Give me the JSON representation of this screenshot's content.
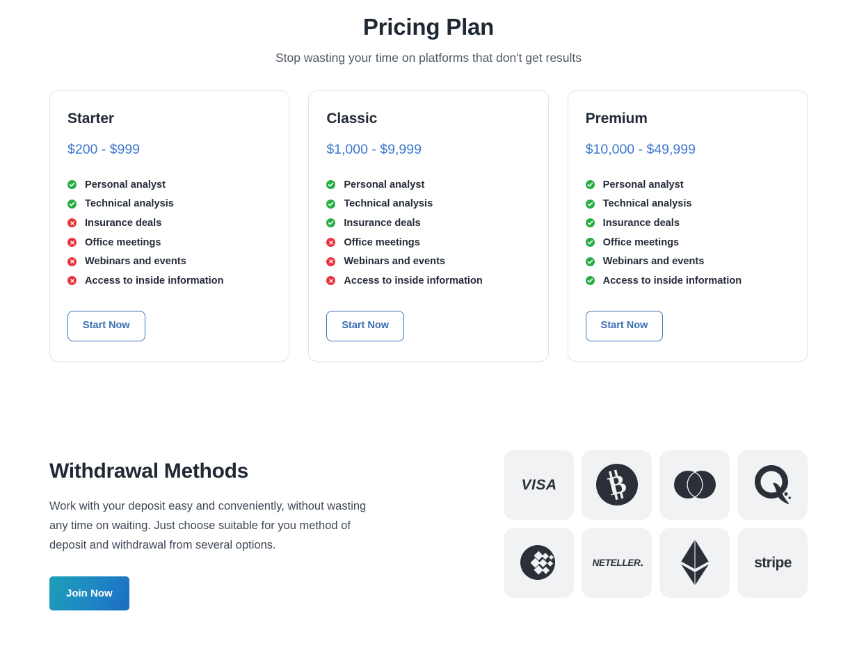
{
  "pricing": {
    "title": "Pricing Plan",
    "subtitle": "Stop wasting your time on platforms that don't get results",
    "accent_color": "#3e77cf",
    "yes_color": "#27ae44",
    "no_color": "#e8343a",
    "plans": [
      {
        "name": "Starter",
        "price": "$200 - $999",
        "cta_label": "Start Now",
        "features": [
          {
            "label": "Personal analyst",
            "included": true,
            "icon": "check-circle-icon"
          },
          {
            "label": "Technical analysis",
            "included": true,
            "icon": "check-circle-icon"
          },
          {
            "label": "Insurance deals",
            "included": false,
            "icon": "x-circle-icon"
          },
          {
            "label": "Office meetings",
            "included": false,
            "icon": "x-circle-icon"
          },
          {
            "label": "Webinars and events",
            "included": false,
            "icon": "x-circle-icon"
          },
          {
            "label": "Access to inside information",
            "included": false,
            "icon": "x-circle-icon"
          }
        ]
      },
      {
        "name": "Classic",
        "price": "$1,000 - $9,999",
        "cta_label": "Start Now",
        "features": [
          {
            "label": "Personal analyst",
            "included": true,
            "icon": "check-circle-icon"
          },
          {
            "label": "Technical analysis",
            "included": true,
            "icon": "check-circle-icon"
          },
          {
            "label": "Insurance deals",
            "included": true,
            "icon": "check-circle-icon"
          },
          {
            "label": "Office meetings",
            "included": false,
            "icon": "x-circle-icon"
          },
          {
            "label": "Webinars and events",
            "included": false,
            "icon": "x-circle-icon"
          },
          {
            "label": "Access to inside information",
            "included": false,
            "icon": "x-circle-icon"
          }
        ]
      },
      {
        "name": "Premium",
        "price": "$10,000 - $49,999",
        "cta_label": "Start Now",
        "features": [
          {
            "label": "Personal analyst",
            "included": true,
            "icon": "check-circle-icon"
          },
          {
            "label": "Technical analysis",
            "included": true,
            "icon": "check-circle-icon"
          },
          {
            "label": "Insurance deals",
            "included": true,
            "icon": "check-circle-icon"
          },
          {
            "label": "Office meetings",
            "included": true,
            "icon": "check-circle-icon"
          },
          {
            "label": "Webinars and events",
            "included": true,
            "icon": "check-circle-icon"
          },
          {
            "label": "Access to inside information",
            "included": true,
            "icon": "check-circle-icon"
          }
        ]
      }
    ]
  },
  "withdrawal": {
    "title": "Withdrawal Methods",
    "body": "Work with your deposit easy and conveniently, without wasting any time on waiting. Just choose suitable for you method of deposit and withdrawal from several options.",
    "cta_label": "Join Now",
    "cta_gradient_from": "#1f9fb8",
    "cta_gradient_to": "#1c6cc2",
    "tile_background": "#f1f2f4",
    "logo_color": "#2b3038",
    "methods": [
      {
        "name": "Visa",
        "icon": "visa-logo-icon",
        "text": "VISA"
      },
      {
        "name": "Bitcoin",
        "icon": "bitcoin-logo-icon",
        "text": ""
      },
      {
        "name": "Mastercard",
        "icon": "mastercard-logo-icon",
        "text": ""
      },
      {
        "name": "Qiwi",
        "icon": "qiwi-logo-icon",
        "text": ""
      },
      {
        "name": "WebMoney",
        "icon": "webmoney-logo-icon",
        "text": ""
      },
      {
        "name": "Neteller",
        "icon": "neteller-logo-icon",
        "text": "NETELLER"
      },
      {
        "name": "Ethereum",
        "icon": "ethereum-logo-icon",
        "text": ""
      },
      {
        "name": "Stripe",
        "icon": "stripe-logo-icon",
        "text": "stripe"
      }
    ]
  }
}
